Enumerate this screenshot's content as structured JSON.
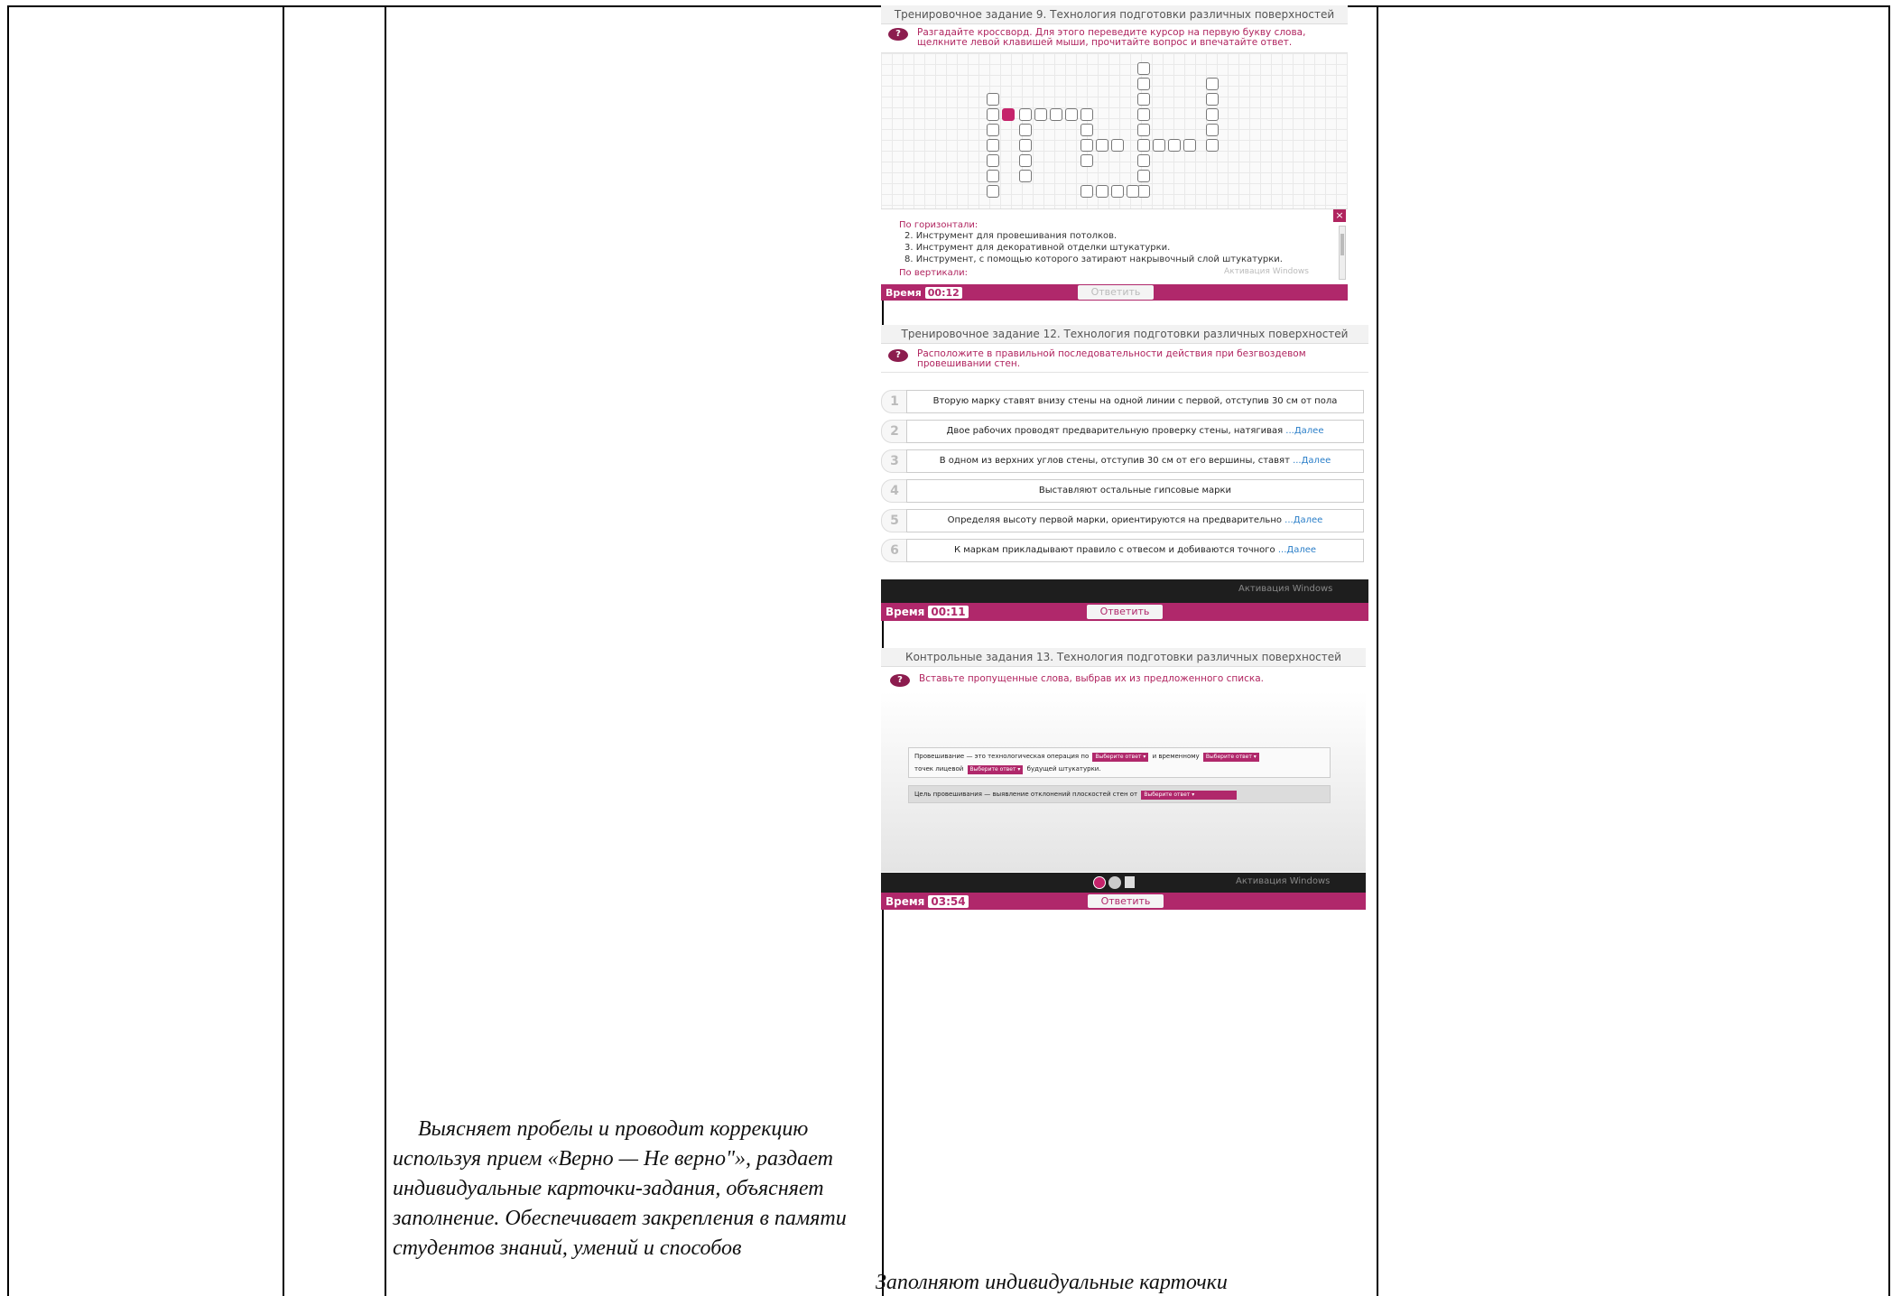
{
  "document": {
    "teacher_text": "Выясняет пробелы и проводит коррекцию используя прием «Верно — Не верно\"», раздает индивидуальные карточки-задания, объясняет заполнение. Обеспечивает закрепления в памяти студентов знаний, умений и способов",
    "student_text": "Заполняют индивидуальные карточки"
  },
  "screenshot1": {
    "title": "Тренировочное задание 9. Технология подготовки различных поверхностей",
    "question": "Разгадайте кроссворд. Для этого переведите курсор на первую букву слова, щелкните левой клавишей мыши, прочитайте вопрос и впечатайте ответ.",
    "icon": "question-icon",
    "horizontal_heading": "По горизонтали:",
    "clues": [
      "2. Инструмент для провешивания потолков.",
      "3. Инструмент для декоративной отделки штукатурки.",
      "8. Инструмент, с помощью которого затирают накрывочный слой штукатурки."
    ],
    "vertical_heading": "По вертикали:",
    "close_label": "×",
    "time_label": "Время",
    "time_value": "00:12",
    "answer_button": "Ответить",
    "watermark": "Активация Windows"
  },
  "screenshot2": {
    "title": "Тренировочное задание 12. Технология подготовки различных поверхностей",
    "question": "Расположите в правильной последовательности действия при безгвоздевом провешивании стен.",
    "steps": [
      {
        "num": "1",
        "text": "Вторую марку ставят внизу стены на одной линии с первой, отступив 30 см от пола",
        "more": ""
      },
      {
        "num": "2",
        "text": "Двое рабочих проводят предварительную проверку стены, натягивая ",
        "more": "...Далее"
      },
      {
        "num": "3",
        "text": "В одном из верхних углов стены, отступив 30 см от его вершины, ставят ",
        "more": "...Далее"
      },
      {
        "num": "4",
        "text": "Выставляют остальные гипсовые марки",
        "more": ""
      },
      {
        "num": "5",
        "text": "Определяя высоту первой марки, ориентируются на предварительно ",
        "more": "...Далее"
      },
      {
        "num": "6",
        "text": "К маркам прикладывают правило с отвесом и добиваются точного ",
        "more": "...Далее"
      }
    ],
    "time_label": "Время",
    "time_value": "00:11",
    "answer_button": "Ответить",
    "watermark": "Активация Windows"
  },
  "screenshot3": {
    "title": "Контрольные задания 13. Технология подготовки различных поверхностей",
    "question": "Вставьте пропущенные слова, выбрав их из предложенного списка.",
    "sentence1_a": "Провешивание — это технологическая операция по",
    "sentence1_b": "и временному",
    "sentence1_c": "точек лицевой",
    "sentence1_d": "будущей штукатурки.",
    "sentence2_a": "Цель провешивания — выявление отклонений плоскостей стен от",
    "dropdown_label": "Выберите ответ",
    "time_label": "Время",
    "time_value": "03:54",
    "answer_button": "Ответить",
    "watermark": "Активация Windows",
    "colors": {
      "accent": "#b0286b",
      "dark": "#1e1e1e"
    }
  }
}
